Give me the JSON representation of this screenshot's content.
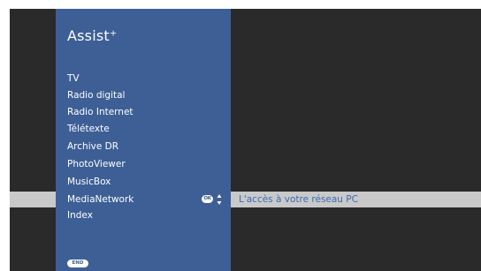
{
  "app": {
    "title": "Assist⁺"
  },
  "menu": {
    "items": [
      {
        "label": "TV"
      },
      {
        "label": "Radio digital"
      },
      {
        "label": "Radio Internet"
      },
      {
        "label": "Télétexte"
      },
      {
        "label": "Archive DR"
      },
      {
        "label": "PhotoViewer"
      },
      {
        "label": "MusicBox"
      },
      {
        "label": "MediaNetwork",
        "selected": true
      },
      {
        "label": "Index"
      }
    ],
    "selected_description": "L'accès à votre réseau PC",
    "ok_key_label": "OK",
    "end_key_label": "END",
    "updown_icon": "up-down-arrows-icon"
  },
  "colors": {
    "panel": "#3d5f96",
    "background": "#2a2a2a",
    "highlight": "#c9c9c9",
    "description_text": "#3d6ab3"
  }
}
